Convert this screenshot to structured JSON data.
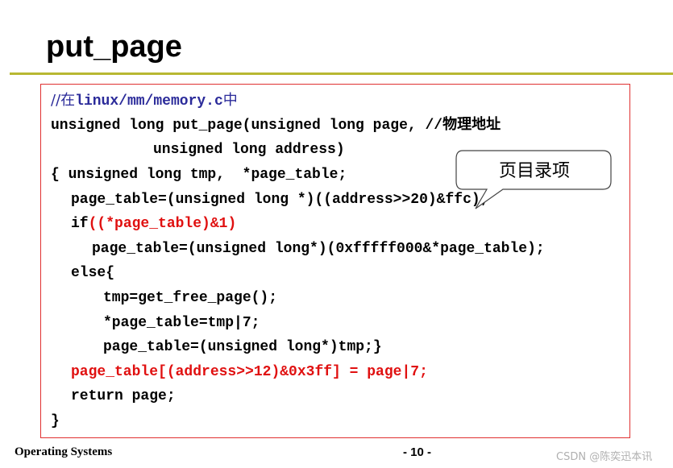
{
  "slide": {
    "title": "put_page"
  },
  "code": {
    "line1_prefix": "//在",
    "line1_path": "linux/mm/memory.c",
    "line1_suffix": "中",
    "line2_code": "unsigned long put_page(unsigned long page, ",
    "line2_comment": "//物理地址",
    "line3": "unsigned long address)",
    "line4": "{ unsigned long tmp,  *page_table;",
    "line5": "page_table=(unsigned long *)((address>>20)&ffc);",
    "line6_prefix": "if",
    "line6_condition": "((*page_table)&1)",
    "line7": "page_table=(unsigned long*)(0xfffff000&*page_table);",
    "line8": "else{",
    "line9": "tmp=get_free_page();",
    "line10": "*page_table=tmp|7;",
    "line11": "page_table=(unsigned long*)tmp;}",
    "line12": "page_table[(address>>12)&0x3ff] = page|7;",
    "line13": "return page;",
    "line14": "}"
  },
  "callout": {
    "label": "页目录项"
  },
  "footer": {
    "course": "Operating Systems",
    "page_number": "- 10 -",
    "watermark": "CSDN @陈奕迅本讯"
  },
  "colors": {
    "accent_rule": "#b8b832",
    "box_border": "#e03030",
    "highlight": "#e01010",
    "comment": "#2b2b9a"
  }
}
